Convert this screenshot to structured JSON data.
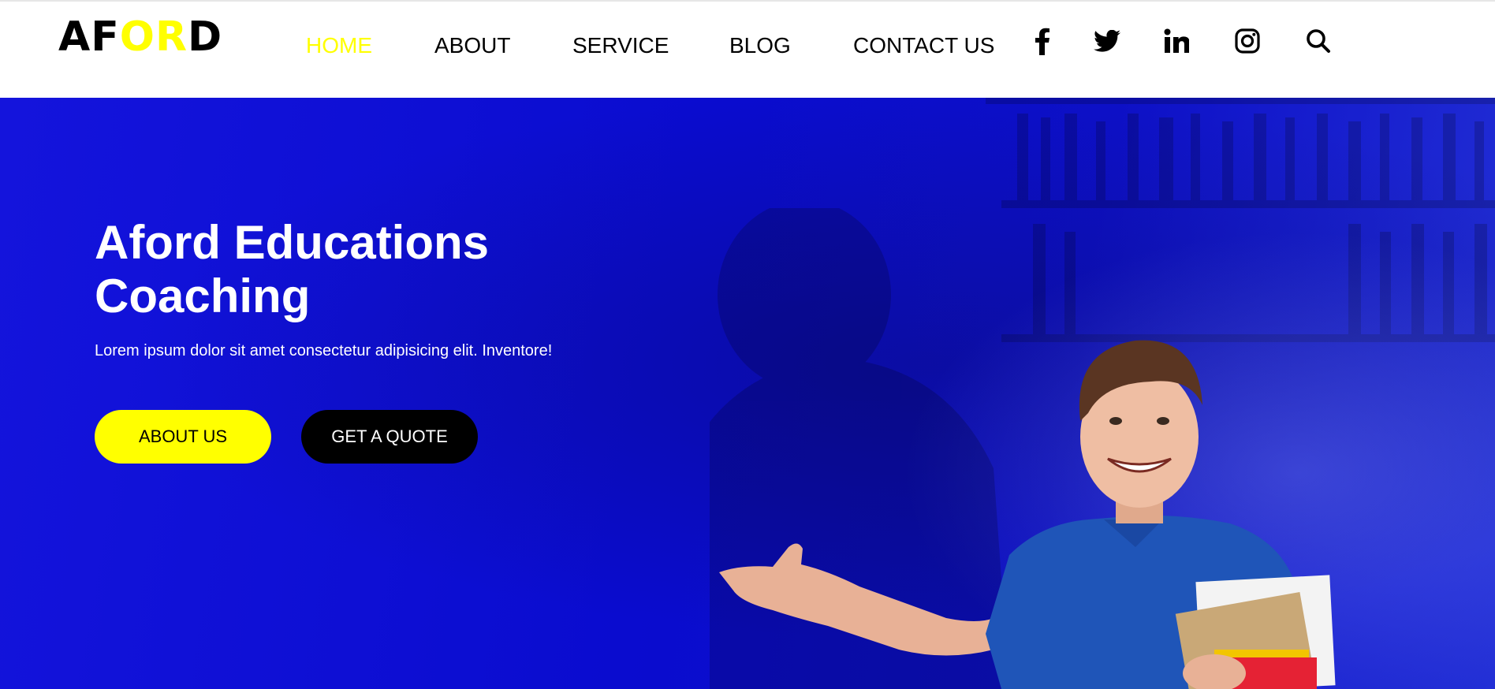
{
  "brand": {
    "logo_part1": "AF",
    "logo_part2": "OR",
    "logo_part3": "D",
    "accent_color": "#ffff00",
    "hero_color": "#0a0ccf"
  },
  "nav": {
    "items": [
      {
        "label": "HOME",
        "active": true
      },
      {
        "label": "ABOUT",
        "active": false
      },
      {
        "label": "SERVICE",
        "active": false
      },
      {
        "label": "BLOG",
        "active": false
      },
      {
        "label": "CONTACT US",
        "active": false
      }
    ]
  },
  "social": [
    "facebook-icon",
    "twitter-icon",
    "linkedin-icon",
    "instagram-icon",
    "search-icon"
  ],
  "hero": {
    "title_line1": "Aford Educations",
    "title_line2": "Coaching",
    "subtitle": "Lorem ipsum dolor sit amet consectetur adipisicing elit. Inventore!",
    "primary_button": "ABOUT US",
    "secondary_button": "GET A QUOTE"
  }
}
